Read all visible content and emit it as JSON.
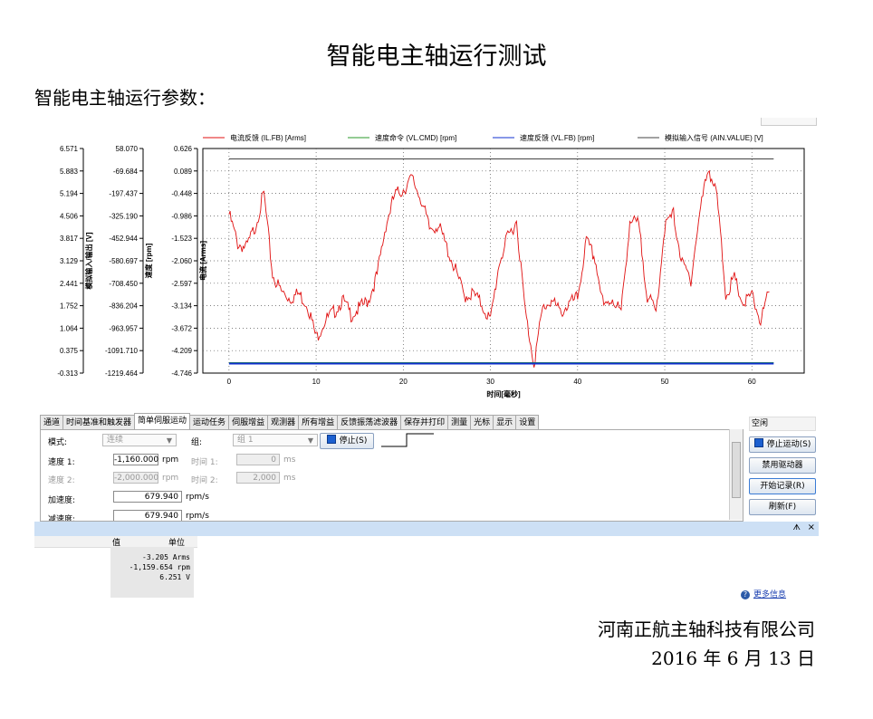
{
  "doc": {
    "title": "智能电主轴运行测试",
    "subtitle": "智能电主轴运行参数：",
    "company": "河南正航主轴科技有限公司",
    "date": "2016 年 6 月 13 日"
  },
  "chart_data": {
    "type": "line",
    "xlabel": "时间[毫秒]",
    "x_ticks": [
      "0",
      "10",
      "20",
      "30",
      "40",
      "50",
      "60"
    ],
    "xlim": [
      -3,
      66
    ],
    "legend": [
      "电流反馈 (IL.FB) [Arms]",
      "速度命令 (VL.CMD) [rpm]",
      "速度反馈 (VL.FB) [rpm]",
      "模拟输入信号 (AIN.VALUE) [V]"
    ],
    "axes": [
      {
        "label": "模拟输入/输出 [V]",
        "ticks": [
          "6.571",
          "5.883",
          "5.194",
          "4.506",
          "3.817",
          "3.129",
          "2.441",
          "1.752",
          "1.064",
          "0.375",
          "-0.313"
        ],
        "ylim": [
          -0.313,
          6.571
        ]
      },
      {
        "label": "速度 [rpm]",
        "ticks": [
          "58.070",
          "-69.684",
          "-197.437",
          "-325.190",
          "-452.944",
          "-580.697",
          "-708.450",
          "-836.204",
          "-963.957",
          "-1091.710",
          "-1219.464"
        ],
        "ylim": [
          -1219.464,
          58.07
        ]
      },
      {
        "label": "电流 [Arms]",
        "ticks": [
          "0.626",
          "0.089",
          "-0.448",
          "-0.986",
          "-1.523",
          "-2.060",
          "-2.597",
          "-3.134",
          "-3.672",
          "-4.209",
          "-4.746"
        ],
        "ylim": [
          -4.746,
          0.626
        ]
      }
    ],
    "grid": true,
    "legend_position": "top",
    "series": [
      {
        "name": "电流反馈 (IL.FB) [Arms]",
        "color": "#e01010",
        "x": [
          0,
          1,
          2,
          3,
          4,
          5,
          6,
          7,
          8,
          9,
          10,
          11,
          12,
          13,
          14,
          15,
          16,
          17,
          18,
          19,
          20,
          21,
          22,
          23,
          24,
          25,
          26,
          27,
          28,
          29,
          30,
          31,
          32,
          33,
          34,
          35,
          36,
          37,
          38,
          39,
          40,
          41,
          42,
          43,
          44,
          45,
          46,
          47,
          48,
          49,
          50,
          51,
          52,
          53,
          54,
          55,
          56,
          57,
          58,
          59,
          60,
          61,
          62
        ],
        "y": [
          -0.95,
          -1.65,
          -1.75,
          -1.25,
          -0.45,
          -2.4,
          -2.8,
          -2.95,
          -2.85,
          -3.1,
          -3.9,
          -3.5,
          -3.3,
          -3.0,
          -3.35,
          -3.2,
          -3.0,
          -2.4,
          -1.2,
          -0.5,
          -0.35,
          -0.1,
          -0.55,
          -1.3,
          -1.2,
          -1.75,
          -2.3,
          -2.9,
          -2.85,
          -3.1,
          -3.5,
          -2.1,
          -1.5,
          -1.1,
          -3.3,
          -4.5,
          -3.2,
          -3.0,
          -3.3,
          -3.1,
          -2.95,
          -1.6,
          -2.0,
          -3.2,
          -2.95,
          -3.3,
          -1.1,
          -1.2,
          -2.9,
          -3.3,
          -1.25,
          -0.95,
          -2.15,
          -2.5,
          -0.95,
          0.2,
          -0.55,
          -2.85,
          -2.5,
          -3.1,
          -2.9,
          -3.5,
          -2.8
        ]
      },
      {
        "name": "速度命令 (VL.CMD) [rpm]",
        "color": "#2a9a2a",
        "x": [
          0,
          62.5
        ],
        "y": [
          -1160,
          -1160
        ]
      },
      {
        "name": "速度反馈 (VL.FB) [rpm]",
        "color": "#1030d0",
        "x": [
          0,
          62.5
        ],
        "y": [
          -1160,
          -1160
        ]
      },
      {
        "name": "模拟输入信号 (AIN.VALUE) [V]",
        "color": "#444444",
        "x": [
          0,
          62.5
        ],
        "y": [
          6.251,
          6.251
        ]
      }
    ]
  },
  "tabs": [
    "通道",
    "时间基准和触发器",
    "简单伺服运动",
    "运动任务",
    "伺服增益",
    "观测器",
    "所有增益",
    "反馈振荡滤波器",
    "保存并打印",
    "测量",
    "光标",
    "显示",
    "设置"
  ],
  "form": {
    "mode_label": "模式:",
    "mode_value": "连续",
    "group_label": "组:",
    "group_value": "组 1",
    "stop_label": "停止(S)",
    "speed1_label": "速度 1:",
    "speed1_value": "-1,160.000",
    "speed1_unit": "rpm",
    "speed2_label": "速度 2:",
    "speed2_value": "-2,000.000",
    "speed2_unit": "rpm",
    "time1_label": "时间 1:",
    "time1_value": "0",
    "time1_unit": "ms",
    "time2_label": "时间 2:",
    "time2_value": "2,000",
    "time2_unit": "ms",
    "accel_label": "加速度:",
    "accel_value": "679.940",
    "accel_unit": "rpm/s",
    "decel_label": "减速度:",
    "decel_value": "679.940",
    "decel_unit": "rpm/s"
  },
  "side": {
    "status": "空闲",
    "stop_motion": "停止运动(S)",
    "disable_drive": "禁用驱动器",
    "start_record": "开始记录(R)",
    "refresh": "刷新(F)"
  },
  "results": {
    "col_value": "值",
    "col_unit": "单位",
    "rows": [
      "-3.205 Arms",
      "-1,159.654 rpm",
      "6.251 V"
    ],
    "more_info": "更多信息"
  }
}
